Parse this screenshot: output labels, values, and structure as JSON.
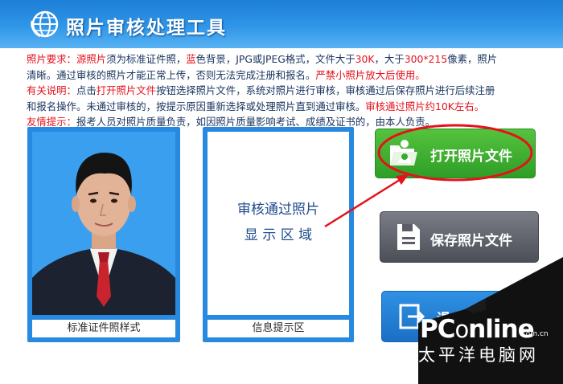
{
  "app": {
    "title": "照片审核处理工具"
  },
  "notice": {
    "line1_label": "照片要求：",
    "line1_src": "源照片",
    "line1_a": "须为标准证件照，",
    "line1_blue": "蓝",
    "line1_b": "色背景，JPG或JPEG格式，文件大于",
    "line1_30k": "30K",
    "line1_c": "，大于",
    "line1_size": "300*215",
    "line1_d": "像素，照片",
    "line2_a": "清晰。通过审核的照片才能正常上传，否则无法完成注册和报名。",
    "line2_red": "严禁小照片放大后使用。",
    "line3_label": "有关说明：",
    "line3_a": "点击",
    "line3_open": "打开照片文件",
    "line3_b": "按钮选择照片文件，系统对照片进行审核，审核通过后保存照片进行后续注册",
    "line4_a": "和报名操作。未通过审核的，按提示原因重新选择或处理照片直到通过审核。",
    "line4_red": "审核通过照片约10K左右。",
    "line5_label": "友情提示：",
    "line5_a": "报考人员对照片质量负责，如因照片质量影响考试、成绩及证书的，由本人负责。"
  },
  "sample_panel": {
    "caption": "标准证件照样式"
  },
  "info_panel": {
    "line1": "审核通过照片",
    "line2": "显 示 区 域",
    "caption": "信息提示区"
  },
  "buttons": {
    "open": "打开照片文件",
    "save": "保存照片文件",
    "exit": "退"
  },
  "icons": {
    "logo": "globe-logo-icon",
    "open": "open-folder-photo-icon",
    "save": "save-document-icon",
    "exit": "exit-icon"
  },
  "watermark": {
    "brand_p": "PC",
    "brand_o": "o",
    "brand_rest": "nline",
    "domain": ".com.cn",
    "cn": "太平洋电脑网"
  },
  "colors": {
    "header": "#2f96e8",
    "accent_red": "#e4121c",
    "open_button": "#3aa92f",
    "save_button": "#5a5d65",
    "exit_button": "#2480d6",
    "panel_blue": "#2789e0"
  }
}
